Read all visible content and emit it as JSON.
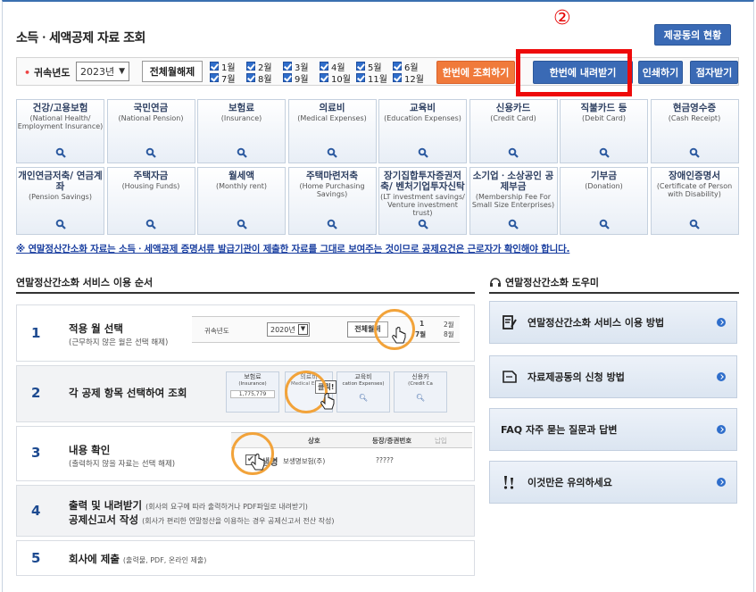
{
  "page": {
    "title": "소득ㆍ세액공제 자료 조회",
    "step_marker": "②",
    "status_button": "제공동의 현황"
  },
  "filter": {
    "year_label": "귀속년도",
    "year_value": "2023년",
    "deselect_all": "전체월해제",
    "months": [
      "1월",
      "2월",
      "3월",
      "4월",
      "5월",
      "6월",
      "7월",
      "8월",
      "9월",
      "10월",
      "11월",
      "12월"
    ],
    "btn_query_once": "한번에 조회하기",
    "btn_download_once": "한번에 내려받기",
    "btn_print": "인쇄하기",
    "btn_braille": "점자받기"
  },
  "categories": [
    {
      "ko": "건강/고용보험",
      "en": "(National Health/ Employment Insurance)"
    },
    {
      "ko": "국민연금",
      "en": "(National Pension)"
    },
    {
      "ko": "보험료",
      "en": "(Insurance)"
    },
    {
      "ko": "의료비",
      "en": "(Medical Expenses)"
    },
    {
      "ko": "교육비",
      "en": "(Education Expenses)"
    },
    {
      "ko": "신용카드",
      "en": "(Credit Card)"
    },
    {
      "ko": "직불카드 등",
      "en": "(Debit Card)"
    },
    {
      "ko": "현금영수증",
      "en": "(Cash Receipt)"
    },
    {
      "ko": "개인연금저축/ 연금계좌",
      "en": "(Pension Savings)"
    },
    {
      "ko": "주택자금",
      "en": "(Housing Funds)"
    },
    {
      "ko": "월세액",
      "en": "(Monthly rent)"
    },
    {
      "ko": "주택마련저축",
      "en": "(Home Purchasing Savings)"
    },
    {
      "ko": "장기집합투자증권저축/ 벤처기업투자신탁",
      "en": "(LT investment savings/ Venture investment trust)"
    },
    {
      "ko": "소기업ㆍ소상공인 공제부금",
      "en": "(Membership Fee For Small Size Enterprises)"
    },
    {
      "ko": "기부금",
      "en": "(Donation)"
    },
    {
      "ko": "장애인증명서",
      "en": "(Certificate of Person with Disability)"
    }
  ],
  "notice": "※ 연말정산간소화 자료는 소득ㆍ세액공제 증명서류 발급기관이 제출한 자료를 그대로 보여주는 것이므로 공제요건은 근로자가 확인해야 합니다.",
  "left_section": {
    "title": "연말정산간소화 서비스 이용 순서",
    "steps": [
      {
        "num": "1",
        "title": "적용 월 선택",
        "sub": "(근무하지 않은 월은 선택 해제)"
      },
      {
        "num": "2",
        "title": "각 공제 항목 선택하여 조회",
        "sub": ""
      },
      {
        "num": "3",
        "title": "내용 확인",
        "sub": "(출력하지 않을 자료는 선택 해제)"
      },
      {
        "num": "4",
        "title": "출력 및 내려받기",
        "inline": "(회사의 요구에 따라 출력하거나 PDF파일로 내려받기)",
        "title2": "공제신고서 작성",
        "inline2": "(회사가 편리한 연말정산을 이용하는 경우 공제신고서 전산 작성)"
      },
      {
        "num": "5",
        "title": "회사에 제출",
        "inline": "(출력물, PDF, 온라인 제출)"
      }
    ],
    "illus1": {
      "year_label": "귀속년도",
      "year": "2020년",
      "deselect": "전체월해",
      "m1": "1",
      "m2": "2월",
      "m7": "7월",
      "m8": "8월"
    },
    "illus2": {
      "c1": "보험료",
      "c1en": "(Insurance)",
      "c1val": "1,775,779",
      "c2": "의료비",
      "c2en": "Medical Expen",
      "click": "클릭!",
      "c3": "교육비",
      "c3en": "cation Expenses)",
      "c4": "신용카",
      "c4en": "(Credit Ca"
    },
    "illus3": {
      "col1": "상호",
      "col2": "등장/증권번호",
      "col3": "납입",
      "row": "생명",
      "row_rest": "보생명보험(주)",
      "val": "?????"
    }
  },
  "right_section": {
    "title": "연말정산간소화 도우미",
    "items": [
      {
        "label": "연말정산간소화 서비스 이용 방법",
        "icon": "document-pen-icon"
      },
      {
        "label": "자료제공동의 신청 방법",
        "icon": "document-icon"
      },
      {
        "label": "FAQ 자주 묻는 질문과 답변",
        "icon": "faq-icon"
      },
      {
        "label": "이것만은 유의하세요",
        "icon": "exclamation-icon"
      }
    ]
  },
  "colors": {
    "accent": "#3a6ab5",
    "orange": "#f07a3b",
    "highlight": "#ee0a0a",
    "ring": "#f2a33a"
  }
}
